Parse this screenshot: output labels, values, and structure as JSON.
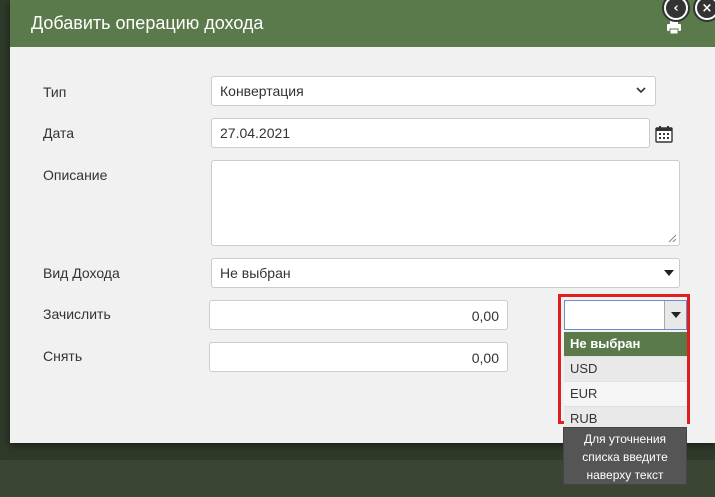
{
  "modal": {
    "title": "Добавить операцию дохода",
    "accent_color": "#5b7a4b"
  },
  "icons": {
    "back": "chevron-left-icon",
    "close": "close-icon",
    "print": "printer-icon",
    "calendar": "calendar-icon"
  },
  "form": {
    "type_label": "Тип",
    "type_value": "Конвертация",
    "date_label": "Дата",
    "date_value": "27.04.2021",
    "description_label": "Описание",
    "description_value": "",
    "income_kind_label": "Вид Дохода",
    "income_kind_value": "Не выбран",
    "credit_label": "Зачислить",
    "credit_value": "0,00",
    "debit_label": "Снять",
    "debit_value": "0,00"
  },
  "currency_dropdown": {
    "input_value": "",
    "options": [
      "Не выбран",
      "USD",
      "EUR",
      "RUB"
    ],
    "selected": "Не выбран",
    "hint": "Для уточнения списка введите наверху текст"
  }
}
